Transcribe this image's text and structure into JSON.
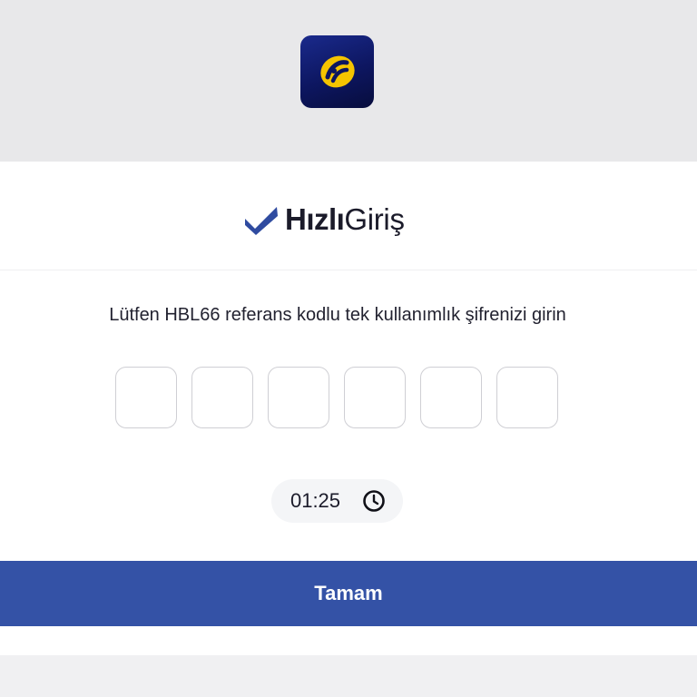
{
  "header": {
    "app_logo_icon": "turkcell-logo-icon",
    "app_logo_colors": {
      "background": "#0d1660",
      "symbol": "#f5c400"
    }
  },
  "brand": {
    "name_bold": "Hızlı",
    "name_light": "Giriş",
    "check_icon": "checkmark-icon",
    "check_color": "#2f4ba0"
  },
  "form": {
    "instruction": "Lütfen HBL66 referans kodlu tek kullanımlık şifrenizi girin",
    "otp_digits": [
      "",
      "",
      "",
      "",
      "",
      ""
    ],
    "timer": "01:25",
    "timer_icon": "clock-icon"
  },
  "actions": {
    "submit_label": "Tamam",
    "submit_color": "#3452a6"
  }
}
